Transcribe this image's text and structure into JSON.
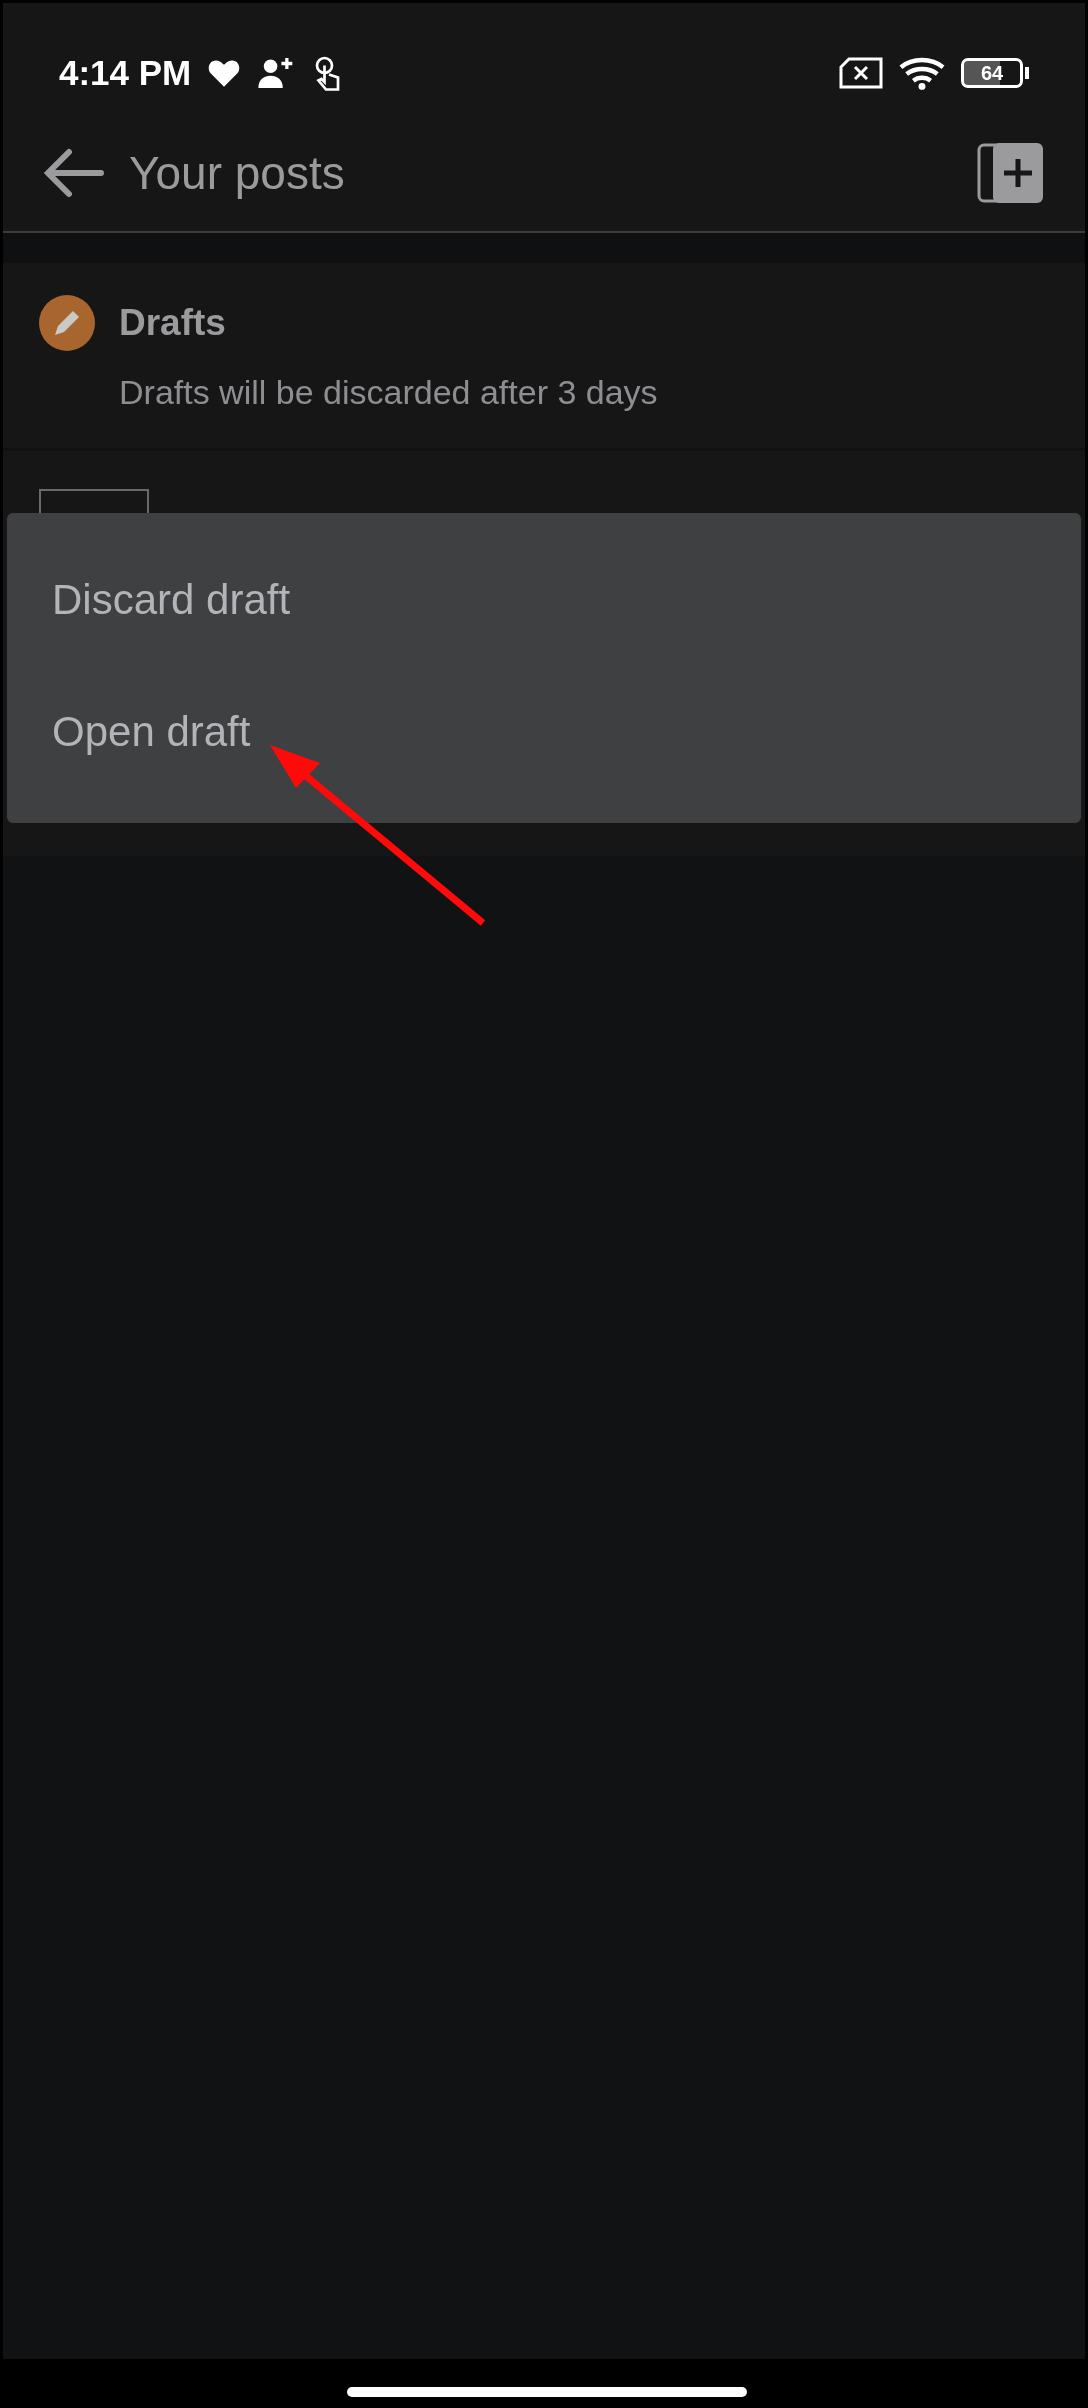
{
  "status_bar": {
    "time": "4:14 PM",
    "battery": "64"
  },
  "toolbar": {
    "title": "Your posts"
  },
  "drafts_section": {
    "title": "Drafts",
    "subtitle": "Drafts will be discarded after 3 days"
  },
  "context_menu": {
    "items": [
      {
        "label": "Discard draft"
      },
      {
        "label": "Open draft"
      }
    ]
  }
}
